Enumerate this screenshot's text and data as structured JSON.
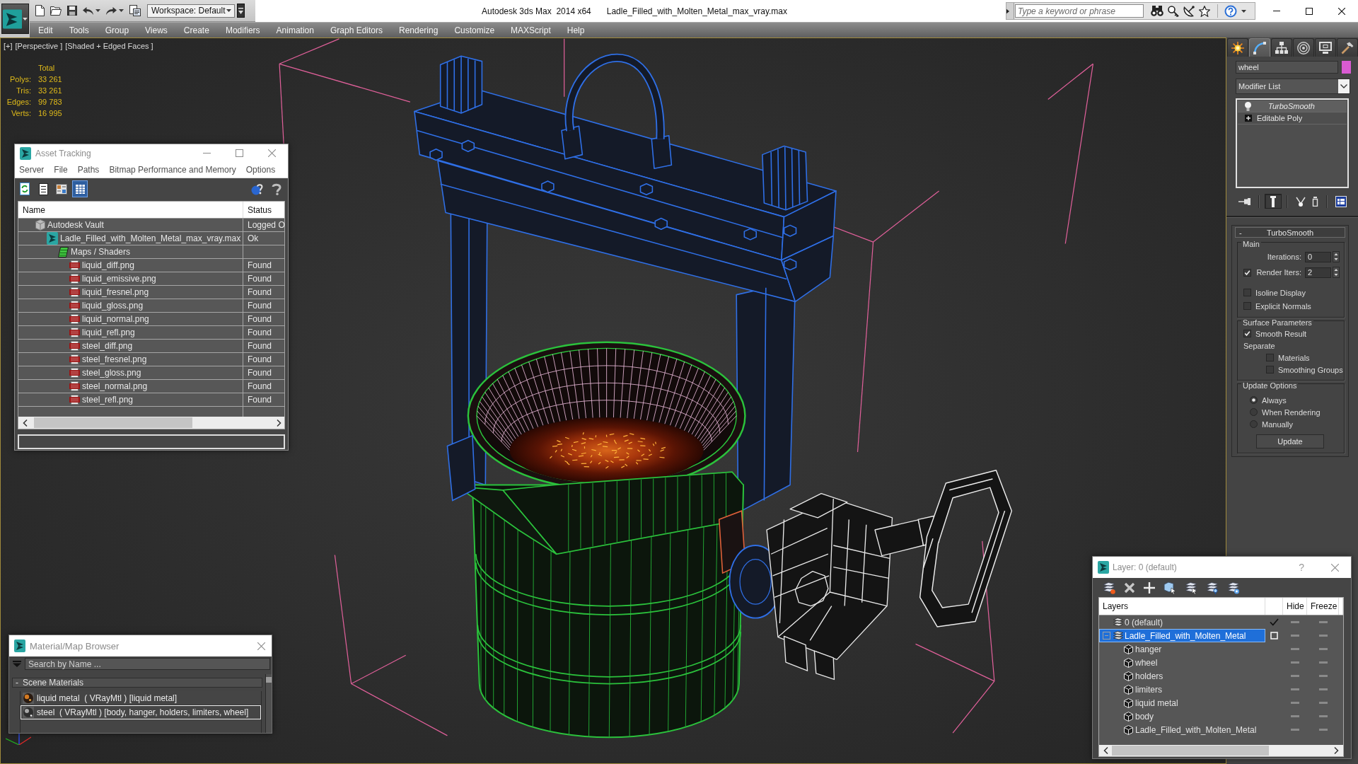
{
  "title_bar": {
    "workspace": "Workspace: Default",
    "app_title": "Autodesk 3ds Max  2014 x64",
    "file_name": "Ladle_Filled_with_Molten_Metal_max_vray.max",
    "search": {
      "placeholder": "Type a keyword or phrase"
    }
  },
  "menu_bar": [
    "Edit",
    "Tools",
    "Group",
    "Views",
    "Create",
    "Modifiers",
    "Animation",
    "Graph Editors",
    "Rendering",
    "Customize",
    "MAXScript",
    "Help"
  ],
  "viewport": {
    "labels": [
      "[+]",
      "[Perspective ]",
      "[Shaded + Edged Faces ]"
    ],
    "stats": {
      "header": "Total",
      "rows": [
        {
          "label": "Polys:",
          "value": "33 261"
        },
        {
          "label": "Tris:",
          "value": "33 261"
        },
        {
          "label": "Edges:",
          "value": "99 783"
        },
        {
          "label": "Verts:",
          "value": "16 995"
        }
      ]
    }
  },
  "asset_tracking": {
    "title": "Asset Tracking",
    "menu": [
      "Server",
      "File",
      "Paths",
      "Bitmap Performance and Memory",
      "Options"
    ],
    "toolbar": [
      {
        "kind": "refresh",
        "selected": false
      },
      {
        "kind": "list",
        "selected": false
      },
      {
        "kind": "thumbnails",
        "selected": false
      },
      {
        "kind": "table",
        "selected": true
      }
    ],
    "columns": {
      "name": "Name",
      "status": "Status"
    },
    "rows": [
      {
        "kind": "vault",
        "name": "Autodesk Vault",
        "status": "Logged O",
        "children": [
          {
            "kind": "scene",
            "name": "Ladle_Filled_with_Molten_Metal_max_vray.max",
            "status": "Ok",
            "children": [
              {
                "kind": "maps",
                "name": "Maps / Shaders",
                "children": [
                  {
                    "kind": "png",
                    "name": "liquid_diff.png",
                    "status": "Found"
                  },
                  {
                    "kind": "png",
                    "name": "liquid_emissive.png",
                    "status": "Found"
                  },
                  {
                    "kind": "png",
                    "name": "liquid_fresnel.png",
                    "status": "Found"
                  },
                  {
                    "kind": "png",
                    "name": "liquid_gloss.png",
                    "status": "Found"
                  },
                  {
                    "kind": "png",
                    "name": "liquid_normal.png",
                    "status": "Found"
                  },
                  {
                    "kind": "png",
                    "name": "liquid_refl.png",
                    "status": "Found"
                  },
                  {
                    "kind": "png",
                    "name": "steel_diff.png",
                    "status": "Found"
                  },
                  {
                    "kind": "png",
                    "name": "steel_fresnel.png",
                    "status": "Found"
                  },
                  {
                    "kind": "png",
                    "name": "steel_gloss.png",
                    "status": "Found"
                  },
                  {
                    "kind": "png",
                    "name": "steel_normal.png",
                    "status": "Found"
                  },
                  {
                    "kind": "png",
                    "name": "steel_refl.png",
                    "status": "Found"
                  }
                ]
              }
            ]
          }
        ]
      }
    ]
  },
  "material_browser": {
    "title": "Material/Map Browser",
    "search": {
      "placeholder": "Search by Name ..."
    },
    "groups": [
      {
        "sign": "-",
        "title": "Scene Materials",
        "items": [
          {
            "kind": "liquid",
            "label": "liquid metal  ( VRayMtl ) [liquid metal]",
            "selected": false
          },
          {
            "kind": "steel",
            "label": "steel  ( VRayMtl ) [body, hanger, holders, limiters, wheel]",
            "selected": true
          }
        ]
      }
    ]
  },
  "command_panel": {
    "tabs": [
      {
        "kind": "create",
        "selected": false
      },
      {
        "kind": "modify",
        "selected": true
      },
      {
        "kind": "hierarchy",
        "selected": false
      },
      {
        "kind": "motion",
        "selected": false
      },
      {
        "kind": "display",
        "selected": false
      },
      {
        "kind": "utilities",
        "selected": false
      }
    ],
    "object_name": "wheel",
    "modifier_list": "Modifier List",
    "stack": [
      {
        "kind": "modifier",
        "label": "TurboSmooth",
        "selected": true
      },
      {
        "kind": "base",
        "label": "Editable Poly",
        "selected": false
      }
    ],
    "stack_tools": [
      {
        "kind": "pin",
        "selected": false
      },
      {
        "kind": "end-result",
        "selected": true
      },
      {
        "kind": "make-unique",
        "selected": false
      },
      {
        "kind": "remove",
        "selected": false
      },
      {
        "kind": "configure",
        "selected": false
      }
    ],
    "rollout": {
      "sign": "-",
      "title": "TurboSmooth",
      "groups": [
        {
          "title": "Main",
          "items": [
            {
              "kind": "spinner",
              "label": "Iterations:",
              "value": "0"
            },
            {
              "kind": "check-spinner",
              "label": "Render Iters:",
              "checked": true,
              "value": "2"
            },
            {
              "kind": "checkbox",
              "label": "Isoline Display",
              "checked": false
            },
            {
              "kind": "checkbox",
              "label": "Explicit Normals",
              "checked": false
            }
          ]
        },
        {
          "title": "Surface Parameters",
          "items": [
            {
              "kind": "checkbox",
              "label": "Smooth Result",
              "checked": true
            },
            {
              "kind": "label",
              "label": "Separate"
            },
            {
              "kind": "sub-checkbox",
              "label": "Materials",
              "checked": false
            },
            {
              "kind": "sub-checkbox",
              "label": "Smoothing Groups",
              "checked": false
            }
          ]
        },
        {
          "title": "Update Options",
          "items": [
            {
              "kind": "radio",
              "label": "Always",
              "selected": true
            },
            {
              "kind": "radio",
              "label": "When Rendering",
              "selected": false
            },
            {
              "kind": "radio",
              "label": "Manually",
              "selected": false
            },
            {
              "kind": "button",
              "label": "Update"
            }
          ]
        }
      ]
    }
  },
  "layer_manager": {
    "title": "Layer: 0 (default)",
    "help": "?",
    "columns": {
      "name": "Layers",
      "hide": "Hide",
      "freeze": "Freeze"
    },
    "rows": [
      {
        "kind": "layer",
        "name": "0 (default)",
        "selected": false,
        "current": true,
        "hidden": false,
        "frozen": false
      },
      {
        "kind": "layer",
        "name": "Ladle_Filled_with_Molten_Metal",
        "selected": true,
        "expanded": true,
        "current": false,
        "hidden": false,
        "frozen": false,
        "children": [
          {
            "kind": "object",
            "name": "hanger",
            "selected": false,
            "hidden": false,
            "frozen": false
          },
          {
            "kind": "object",
            "name": "wheel",
            "selected": false,
            "hidden": false,
            "frozen": false
          },
          {
            "kind": "object",
            "name": "holders",
            "selected": false,
            "hidden": false,
            "frozen": false
          },
          {
            "kind": "object",
            "name": "limiters",
            "selected": false,
            "hidden": false,
            "frozen": false
          },
          {
            "kind": "object",
            "name": "liquid metal",
            "selected": false,
            "hidden": false,
            "frozen": false
          },
          {
            "kind": "object",
            "name": "body",
            "selected": false,
            "hidden": false,
            "frozen": false
          },
          {
            "kind": "object",
            "name": "Ladle_Filled_with_Molten_Metal",
            "selected": false,
            "hidden": false,
            "frozen": false
          }
        ]
      }
    ]
  }
}
